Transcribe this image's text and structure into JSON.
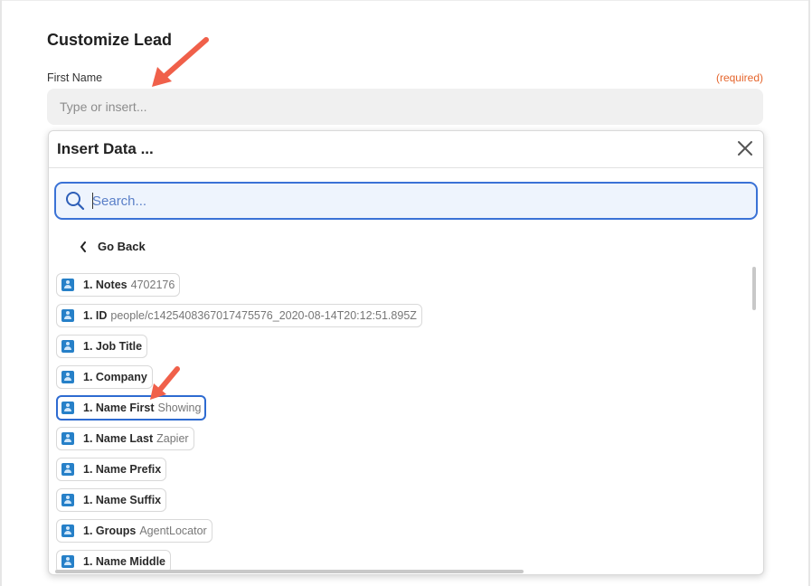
{
  "section": {
    "title": "Customize Lead"
  },
  "field": {
    "label": "First Name",
    "required": "(required)",
    "placeholder": "Type or insert..."
  },
  "popover": {
    "title": "Insert Data ...",
    "close_icon": "close-icon",
    "search_placeholder": "Search...",
    "go_back": "Go Back",
    "items": [
      {
        "key": "1. Notes",
        "value": "4702176"
      },
      {
        "key": "1. ID",
        "value": "people/c1425408367017475576_2020-08-14T20:12:51.895Z"
      },
      {
        "key": "1. Job Title",
        "value": ""
      },
      {
        "key": "1. Company",
        "value": ""
      },
      {
        "key": "1. Name First",
        "value": "Showing",
        "selected": true
      },
      {
        "key": "1. Name Last",
        "value": "Zapier"
      },
      {
        "key": "1. Name Prefix",
        "value": ""
      },
      {
        "key": "1. Name Suffix",
        "value": ""
      },
      {
        "key": "1. Groups",
        "value": "AgentLocator"
      },
      {
        "key": "1. Name Middle",
        "value": ""
      }
    ]
  },
  "colors": {
    "accent": "#3a72d6",
    "required": "#e5652c",
    "annotation_arrow": "#f0604a",
    "app_icon": "#2680c8"
  }
}
